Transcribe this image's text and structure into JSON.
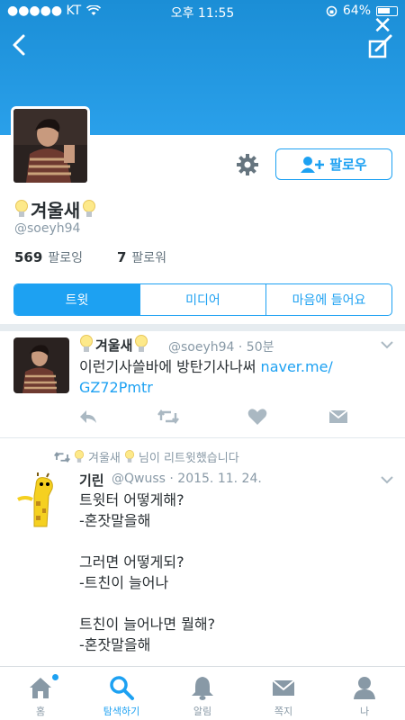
{
  "status_bar": {
    "carrier": "●●●●● KT",
    "time": "오후 11:55",
    "battery": "64%"
  },
  "profile": {
    "display_name": "겨울새",
    "handle": "@soeyh94",
    "following_count": "569",
    "following_label": "팔로잉",
    "followers_count": "7",
    "followers_label": "팔로워",
    "follow_button": "팔로우"
  },
  "tabs": [
    {
      "label": "트윗",
      "active": true
    },
    {
      "label": "미디어",
      "active": false
    },
    {
      "label": "마음에 들어요",
      "active": false
    }
  ],
  "tweets": [
    {
      "name": "겨울새",
      "handle": "@soeyh94",
      "time": "· 50분",
      "text": "이런기사쓸바에 방탄기사나써 ",
      "link": "naver.me/\nGZ72Pmtr"
    },
    {
      "retweet_by": "겨울새",
      "retweet_suffix": "님이 리트윗했습니다",
      "name": "기린",
      "handle": "@Qwuss",
      "time": "· 2015. 11. 24.",
      "text": "트윗터 어떻게해?\n-혼잣말을해\n\n그러면 어떻게되?\n-트친이 늘어나\n\n트친이 늘어나면 뭘해?\n-혼잣말을해"
    }
  ],
  "tab_bar": [
    {
      "label": "홈",
      "icon": "home-icon"
    },
    {
      "label": "탐색하기",
      "icon": "search-icon"
    },
    {
      "label": "알림",
      "icon": "bell-icon"
    },
    {
      "label": "쪽지",
      "icon": "envelope-icon"
    },
    {
      "label": "나",
      "icon": "person-icon"
    }
  ],
  "colors": {
    "accent": "#1da1f2",
    "header": "#2196e6"
  }
}
